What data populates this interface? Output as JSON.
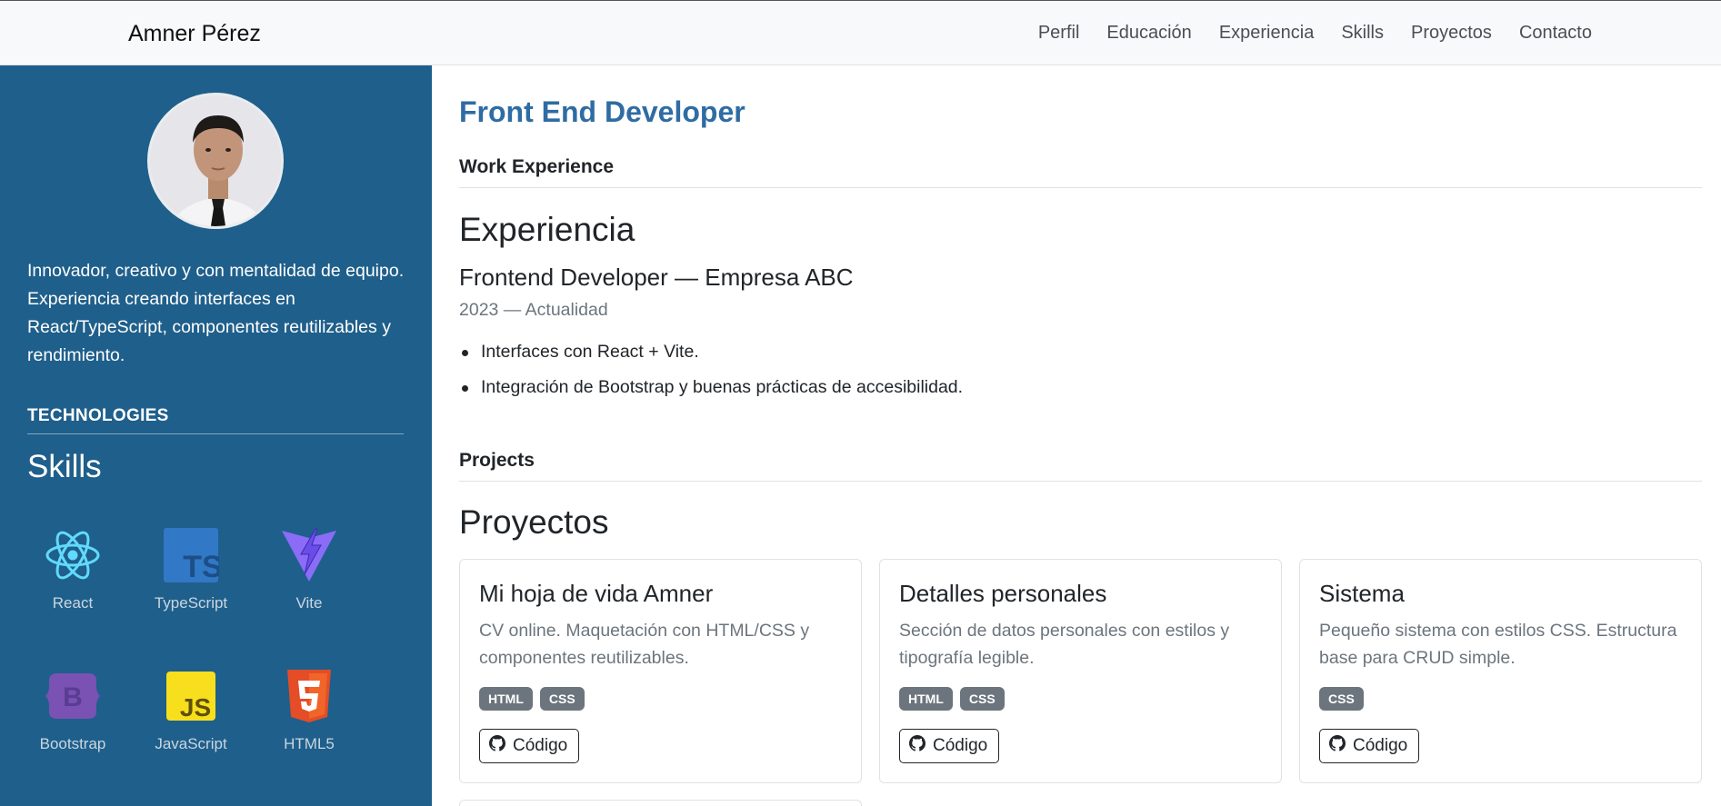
{
  "navbar": {
    "brand": "Amner Pérez",
    "links": [
      "Perfil",
      "Educación",
      "Experiencia",
      "Skills",
      "Proyectos",
      "Contacto"
    ]
  },
  "sidebar": {
    "bio": "Innovador, creativo y con mentalidad de equipo. Experiencia creando interfaces en React/TypeScript, componentes reutilizables y rendimiento.",
    "technologies_heading": "TECHNOLOGIES",
    "skills_title": "Skills",
    "skills": [
      {
        "label": "React",
        "icon": "react-icon"
      },
      {
        "label": "TypeScript",
        "icon": "typescript-icon"
      },
      {
        "label": "Vite",
        "icon": "vite-icon"
      },
      {
        "label": "Bootstrap",
        "icon": "bootstrap-icon"
      },
      {
        "label": "JavaScript",
        "icon": "javascript-icon"
      },
      {
        "label": "HTML5",
        "icon": "html5-icon"
      }
    ]
  },
  "main": {
    "role": "Front End Developer",
    "work_label": "Work Experience",
    "experience_title": "Experiencia",
    "job": {
      "title": "Frontend Developer — Empresa ABC",
      "period": "2023 — Actualidad",
      "bullets": [
        "Interfaces con React + Vite.",
        "Integración de Bootstrap y buenas prácticas de accesibilidad."
      ]
    },
    "projects_label": "Projects",
    "projects_title": "Proyectos",
    "projects": [
      {
        "title": "Mi hoja de vida Amner",
        "description": "CV online. Maquetación con HTML/CSS y componentes reutilizables.",
        "badges": [
          "HTML",
          "CSS"
        ],
        "button": "Código"
      },
      {
        "title": "Detalles personales",
        "description": "Sección de datos personales con estilos y tipografía legible.",
        "badges": [
          "HTML",
          "CSS"
        ],
        "button": "Código"
      },
      {
        "title": "Sistema",
        "description": "Pequeño sistema con estilos CSS. Estructura base para CRUD simple.",
        "badges": [
          "CSS"
        ],
        "button": "Código"
      }
    ]
  },
  "colors": {
    "sidebar_bg": "#1f5f8b",
    "accent": "#2f6ca3",
    "badge": "#6c757d"
  }
}
